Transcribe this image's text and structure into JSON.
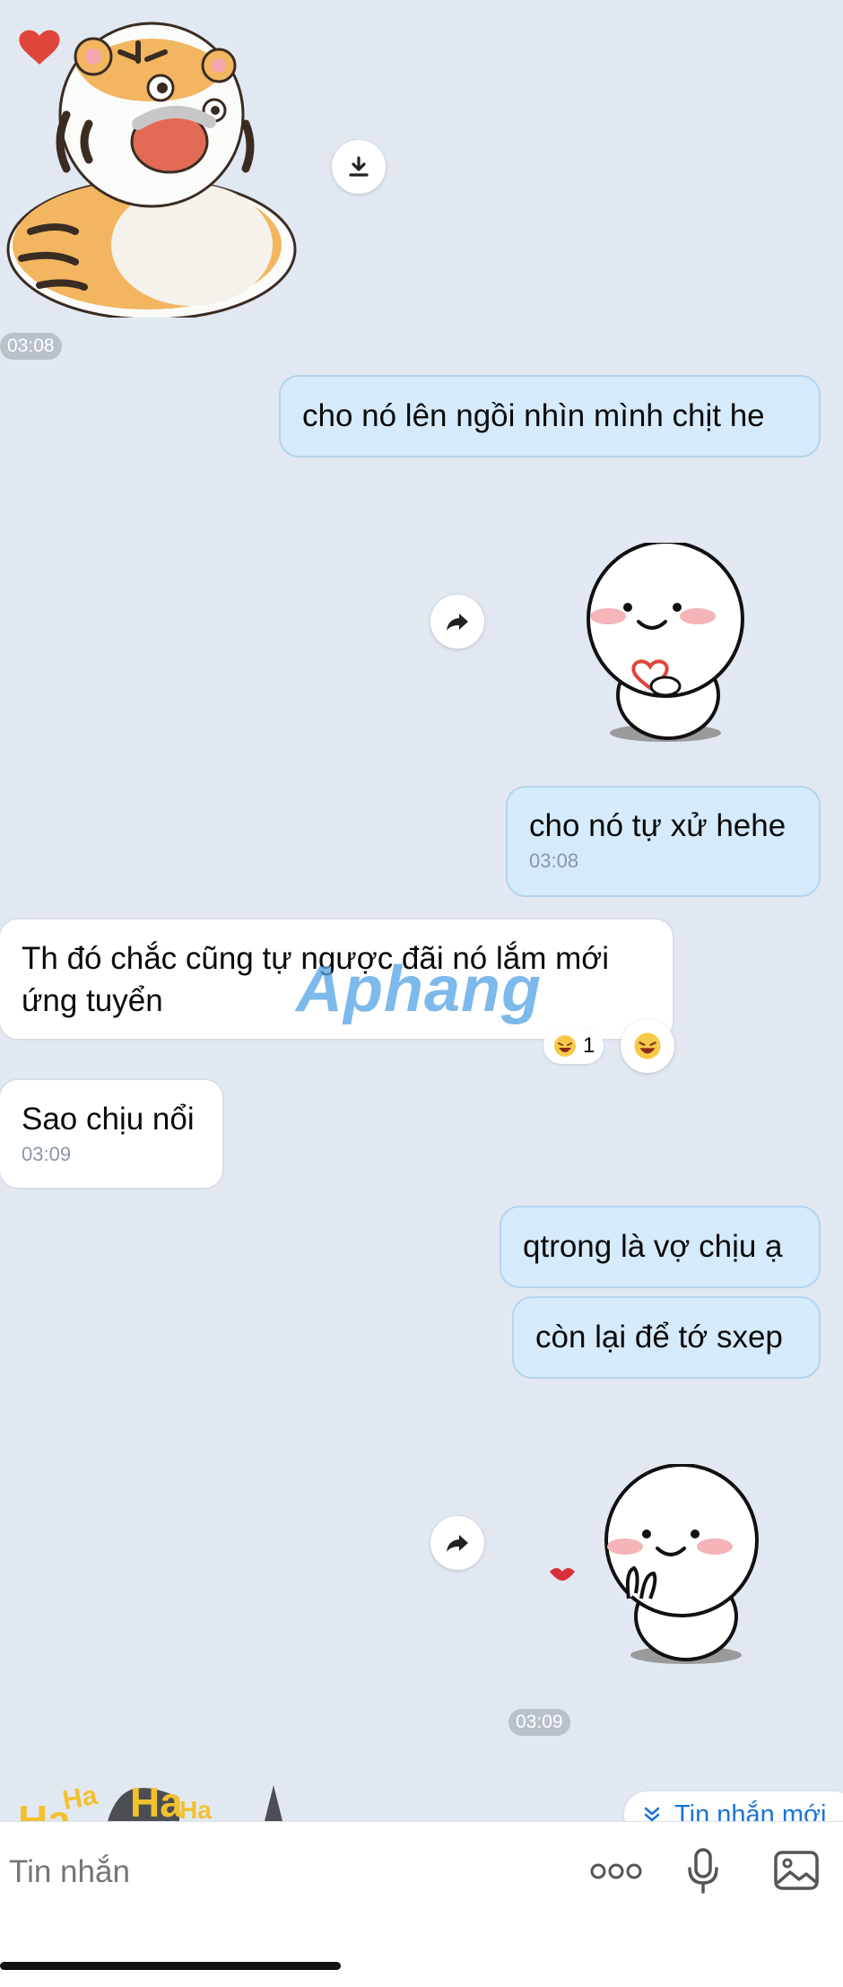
{
  "messages": {
    "m1_time": "03:08",
    "m2_text": "cho nó lên ngồi nhìn mình chịt he",
    "m4_text": "cho nó tự xử hehe",
    "m4_time": "03:08",
    "m5_line1": "Th đó chắc cũng tự ngược đãi nó lắm mới",
    "m5_line2": "ứng tuyển",
    "m5_reaction_count": "1",
    "m6_text": "Sao chịu nổi",
    "m6_time": "03:09",
    "m7_text": "qtrong là vợ chịu ạ",
    "m8_text": "còn lại để tớ sxep",
    "m9_time": "03:09"
  },
  "sticker_text": {
    "haha1": "Ha",
    "haha2": "Ha",
    "haha3": "Ha",
    "haha4": "Ha"
  },
  "watermark": "Aphang",
  "new_messages_label": "Tin nhắn mới",
  "composer": {
    "placeholder": "Tin nhắn"
  },
  "colors": {
    "background": "#e2e8f1",
    "outgoing_bubble": "#d5eafb",
    "incoming_bubble": "#ffffff",
    "accent": "#1a73d9"
  },
  "icons": [
    "download-icon",
    "share-arrow-icon",
    "laughing-emoji-icon",
    "chevron-double-down-icon",
    "more-dots-icon",
    "microphone-icon",
    "image-icon"
  ]
}
